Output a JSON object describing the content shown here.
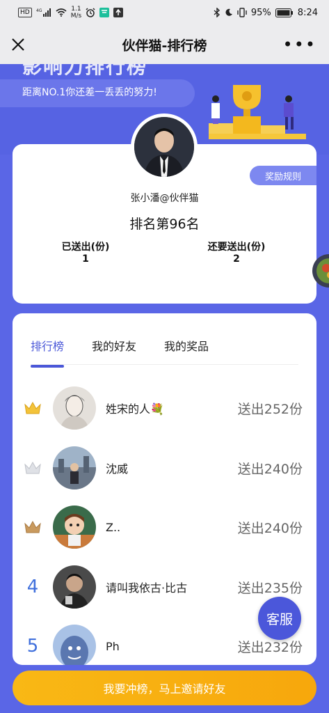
{
  "status_bar": {
    "hd": "HD",
    "net": "4G",
    "speed_value": "1.1",
    "speed_unit": "M/s",
    "battery": "95%",
    "time": "8:24"
  },
  "nav": {
    "title": "伙伴猫-排行榜"
  },
  "hero": {
    "cut_title": "影响力排行榜",
    "subtitle": "距离NO.1你还差一丢丢的努力!"
  },
  "profile": {
    "rules_label": "奖励规则",
    "username": "张小潘@伙伴猫",
    "rank_text": "排名第96名",
    "sent_label": "已送出(份)",
    "sent_value": "1",
    "need_label": "还要送出(份)",
    "need_value": "2"
  },
  "tabs": [
    {
      "label": "排行榜",
      "active": true
    },
    {
      "label": "我的好友",
      "active": false
    },
    {
      "label": "我的奖品",
      "active": false
    }
  ],
  "leaderboard": [
    {
      "rank": "1",
      "name": "姓宋的人💐",
      "sent": "送出252份",
      "medal": "gold"
    },
    {
      "rank": "2",
      "name": "沈威",
      "sent": "送出240份",
      "medal": "silver"
    },
    {
      "rank": "3",
      "name": "Z..",
      "sent": "送出240份",
      "medal": "bronze"
    },
    {
      "rank": "4",
      "name": "请叫我依古·比古",
      "sent": "送出235份",
      "medal": ""
    },
    {
      "rank": "5",
      "name": "Ph",
      "sent": "送出232份",
      "medal": ""
    }
  ],
  "service_label": "客服",
  "cta_label": "我要冲榜，马上邀请好友",
  "colors": {
    "primary": "#4a57d8",
    "background": "#5a66e6",
    "cta": "#f9b815"
  }
}
